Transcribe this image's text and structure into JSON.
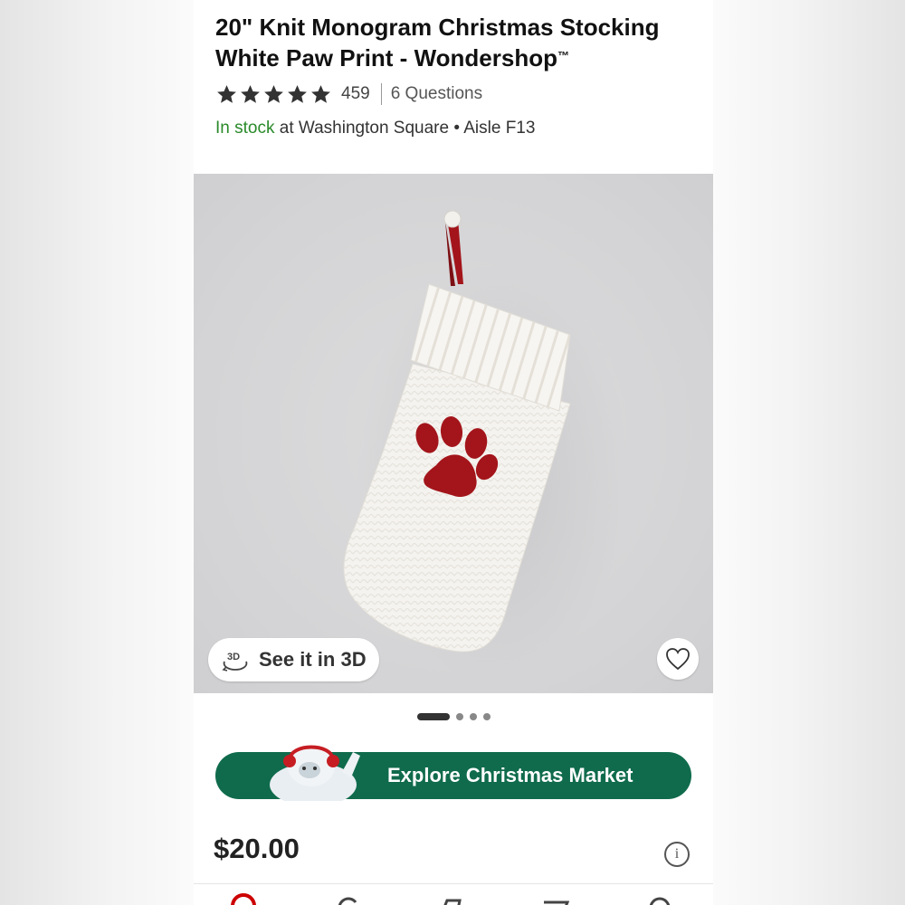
{
  "product": {
    "title": "20\" Knit Monogram Christmas Stocking White Paw Print - Wondershop",
    "trademark": "™",
    "rating": 5,
    "review_count": "459",
    "questions_label": "6 Questions",
    "stock_status": "In stock",
    "stock_location": "at Washington Square • Aisle F13",
    "price": "$20.00"
  },
  "media": {
    "view_3d_label": "See it in 3D",
    "image_count": 4,
    "active_image": 1
  },
  "promo": {
    "label": "Explore Christmas Market"
  },
  "icons": {
    "star": "star-icon",
    "view_3d": "3d-rotate-icon",
    "favorite": "heart-icon",
    "info": "info-icon"
  },
  "colors": {
    "in_stock": "#2a8a2a",
    "promo_bg": "#0f6b4c",
    "stocking_accent": "#a3151b",
    "brand_red": "#cc0000"
  }
}
